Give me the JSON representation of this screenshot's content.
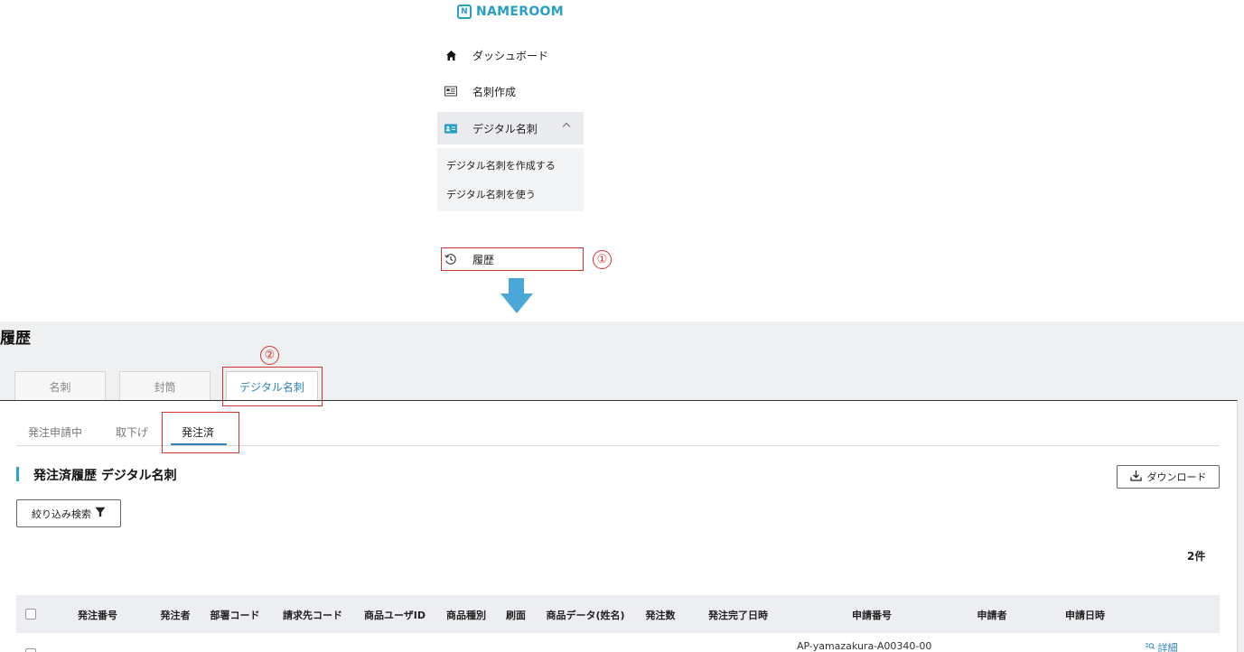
{
  "nav": {
    "logo_text": "NAMEROOM",
    "logo_mark": "N",
    "items": [
      {
        "label": "ダッシュボード",
        "icon": "home-icon"
      },
      {
        "label": "名刺作成",
        "icon": "card-icon"
      },
      {
        "label": "デジタル名刺",
        "icon": "id-card-icon"
      }
    ],
    "submenu": [
      "デジタル名刺を作成する",
      "デジタル名刺を使う"
    ],
    "history_label": "履歴",
    "annotation_1": "①"
  },
  "history": {
    "page_title": "履歴",
    "annotation_2": "②",
    "tabs": [
      "名刺",
      "封筒",
      "デジタル名刺"
    ],
    "subtabs": [
      "発注申請中",
      "取下げ",
      "発注済"
    ],
    "section_title": "発注済履歴 デジタル名刺",
    "download_label": "ダウンロード",
    "filter_label": "絞り込み検索",
    "count": "2件",
    "columns": [
      "発注番号",
      "発注者",
      "部署コード",
      "請求先コード",
      "商品ユーザID",
      "商品種別",
      "刷面",
      "商品データ(姓名)",
      "発注数",
      "発注完了日時",
      "申請番号",
      "申請者",
      "申請日時"
    ],
    "row": {
      "application_no": "AP-yamazakura-A00340-00",
      "detail_label": "詳細"
    }
  },
  "colors": {
    "accent": "#2d83b8",
    "brand": "#2a9fc6",
    "highlight": "#d4322f",
    "arrow": "#4aa8d8"
  }
}
